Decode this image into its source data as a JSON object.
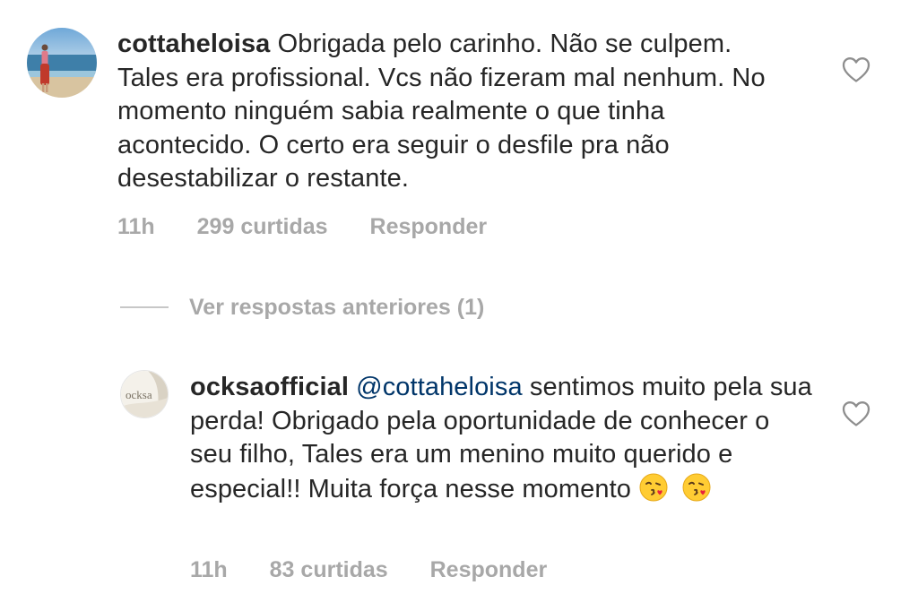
{
  "comments": [
    {
      "username": "cottaheloisa",
      "text": "Obrigada pelo carinho. Não se culpem. Tales era profissional.  Vcs não fizeram mal nenhum. No momento ninguém sabia realmente o que tinha acontecido. O certo era seguir o desfile pra não desestabilizar o restante.",
      "time": "11h",
      "likes": "299 curtidas",
      "reply_label": "Responder"
    },
    {
      "username": "ocksaofficial",
      "mention": "@cottaheloisa",
      "text": "sentimos muito pela sua perda! Obrigado pela oportunidade de conhecer o seu filho, Tales era um menino muito querido e especial!! Muita força nesse momento",
      "emoji": "kissing-heart-emoji",
      "time": "11h",
      "likes": "83 curtidas",
      "reply_label": "Responder",
      "avatar_text": "ocksa"
    }
  ],
  "view_replies_label": "Ver respostas anteriores (1)",
  "colors": {
    "text": "#262626",
    "meta": "#a8a8a8",
    "mention": "#003569",
    "rule": "#c7c7c7"
  }
}
